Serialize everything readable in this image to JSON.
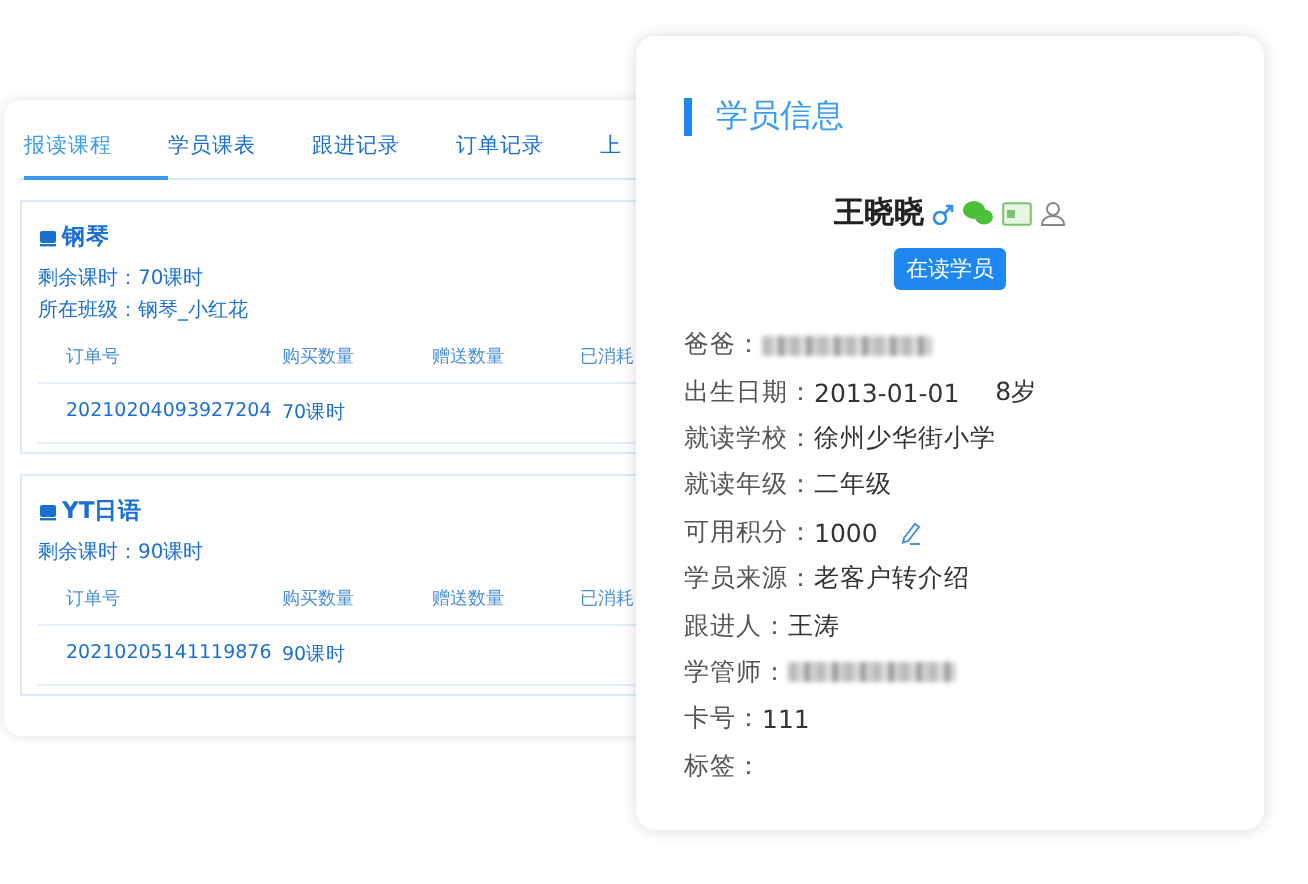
{
  "course_panel": {
    "tabs": [
      {
        "label": "报读课程",
        "selected": true
      },
      {
        "label": "学员课表",
        "selected": false
      },
      {
        "label": "跟进记录",
        "selected": false
      },
      {
        "label": "订单记录",
        "selected": false
      },
      {
        "label": "上",
        "selected": false
      }
    ],
    "courses": [
      {
        "name": "钢琴",
        "info": [
          {
            "label": "剩余课时：",
            "value": "70课时"
          },
          {
            "label": "所在班级：",
            "value": "钢琴_小红花"
          }
        ],
        "columns": [
          "订单号",
          "购买数量",
          "赠送数量",
          "已消耗"
        ],
        "rows": [
          [
            "20210204093927204",
            "70课时"
          ]
        ]
      },
      {
        "name": "YT日语",
        "info": [
          {
            "label": "剩余课时：",
            "value": "90课时"
          }
        ],
        "columns": [
          "订单号",
          "购买数量",
          "赠送数量",
          "已消耗"
        ],
        "rows": [
          [
            "20210205141119876",
            "90课时"
          ]
        ]
      }
    ]
  },
  "student_panel": {
    "title": "学员信息",
    "name": "王晓晓",
    "status": "在读学员",
    "fields": [
      {
        "label": "爸爸：",
        "kind": "redacted"
      },
      {
        "label": "出生日期：",
        "kind": "text",
        "value": "2013-01-01",
        "extra": "8岁"
      },
      {
        "label": "就读学校：",
        "kind": "text",
        "value": "徐州少华街小学"
      },
      {
        "label": "就读年级：",
        "kind": "text",
        "value": "二年级"
      },
      {
        "label": "可用积分：",
        "kind": "editable",
        "value": "1000"
      },
      {
        "label": "学员来源：",
        "kind": "text",
        "value": "老客户转介绍"
      },
      {
        "label": "跟进人：",
        "kind": "text",
        "value": "王涛"
      },
      {
        "label": "学管师：",
        "kind": "redacted"
      },
      {
        "label": "卡号：",
        "kind": "text",
        "value": "111"
      },
      {
        "label": "标签：",
        "kind": "empty"
      }
    ]
  }
}
